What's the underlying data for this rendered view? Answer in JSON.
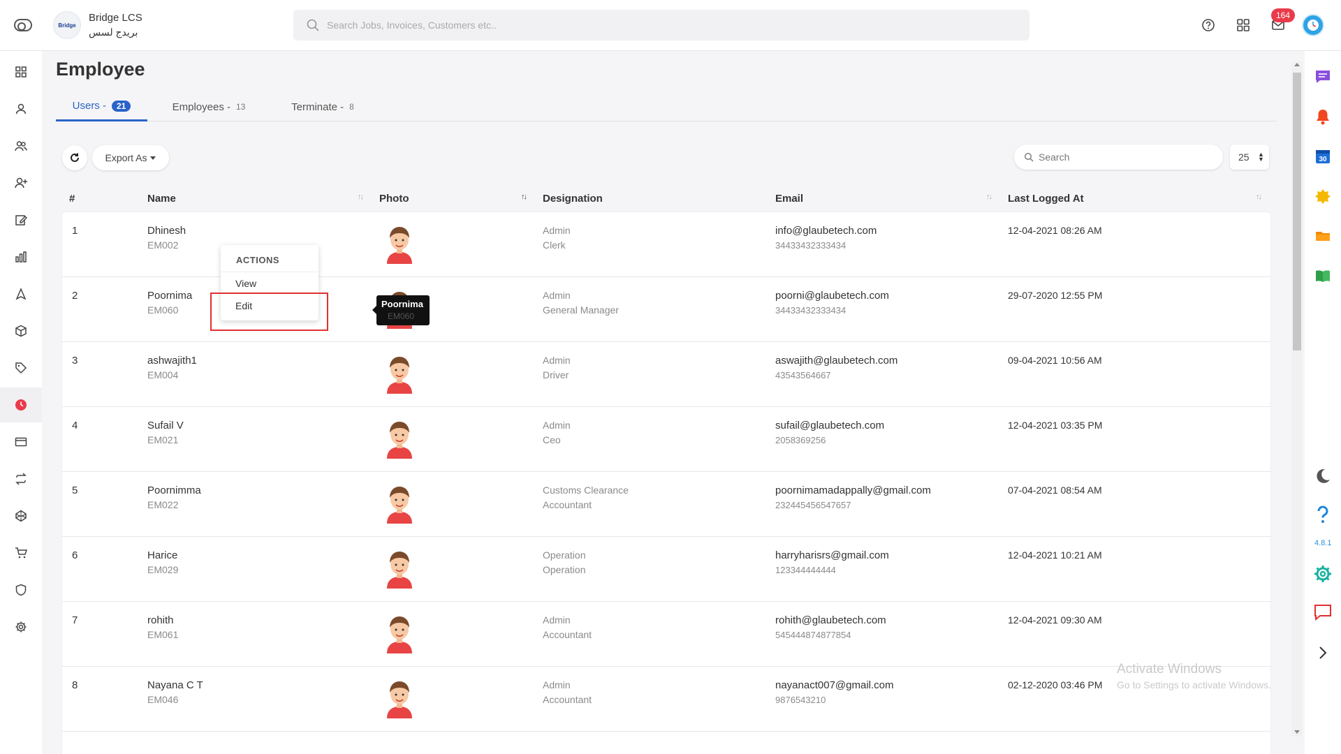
{
  "header": {
    "company_name": "Bridge LCS",
    "company_name_arabic": "بريدج لسس",
    "logo_text": "Bridge",
    "search_placeholder": "Search Jobs, Invoices, Customers etc..",
    "mail_badge": "164"
  },
  "page": {
    "title": "Employee"
  },
  "tabs": [
    {
      "label": "Users -",
      "count": "21"
    },
    {
      "label": "Employees -",
      "count": "13"
    },
    {
      "label": "Terminate -",
      "count": "8"
    }
  ],
  "toolbar": {
    "export_label": "Export As",
    "search_placeholder": "Search",
    "page_size": "25"
  },
  "table": {
    "headers": [
      "#",
      "Name",
      "Photo",
      "Designation",
      "Email",
      "Last Logged At"
    ],
    "rows": [
      {
        "no": "1",
        "name": "Dhinesh",
        "code": "EM002",
        "dept": "Admin",
        "role": "Clerk",
        "email": "info@glaubetech.com",
        "phone": "34433432333434",
        "last": "12-04-2021 08:26 AM"
      },
      {
        "no": "2",
        "name": "Poornima",
        "code": "EM060",
        "dept": "Admin",
        "role": "General Manager",
        "email": "poorni@glaubetech.com",
        "phone": "34433432333434",
        "last": "29-07-2020 12:55 PM"
      },
      {
        "no": "3",
        "name": "ashwajith1",
        "code": "EM004",
        "dept": "Admin",
        "role": "Driver",
        "email": "aswajith@glaubetech.com",
        "phone": "43543564667",
        "last": "09-04-2021 10:56 AM"
      },
      {
        "no": "4",
        "name": "Sufail V",
        "code": "EM021",
        "dept": "Admin",
        "role": "Ceo",
        "email": "sufail@glaubetech.com",
        "phone": "2058369256",
        "last": "12-04-2021 03:35 PM"
      },
      {
        "no": "5",
        "name": "Poornimma",
        "code": "EM022",
        "dept": "Customs Clearance",
        "role": "Accountant",
        "email": "poornimamadappally@gmail.com",
        "phone": "232445456547657",
        "last": "07-04-2021 08:54 AM"
      },
      {
        "no": "6",
        "name": "Harice",
        "code": "EM029",
        "dept": "Operation",
        "role": "Operation",
        "email": "harryharisrs@gmail.com",
        "phone": "123344444444",
        "last": "12-04-2021 10:21 AM"
      },
      {
        "no": "7",
        "name": "rohith",
        "code": "EM061",
        "dept": "Admin",
        "role": "Accountant",
        "email": "rohith@glaubetech.com",
        "phone": "545444874877854",
        "last": "12-04-2021 09:30 AM"
      },
      {
        "no": "8",
        "name": "Nayana C T",
        "code": "EM046",
        "dept": "Admin",
        "role": "Accountant",
        "email": "nayanact007@gmail.com",
        "phone": "9876543210",
        "last": "02-12-2020 03:46 PM"
      }
    ]
  },
  "actions_menu": {
    "title": "ACTIONS",
    "view": "View",
    "edit": "Edit"
  },
  "tooltip": {
    "name": "Poornima",
    "code": "EM060"
  },
  "right_rail": {
    "calendar_day": "30",
    "version": "4.8.1"
  },
  "watermark": {
    "line1": "Activate Windows",
    "line2": "Go to Settings to activate Windows."
  },
  "colors": {
    "accent": "#2a63c9",
    "badge": "#ea3b4a",
    "highlight": "#e23030"
  }
}
